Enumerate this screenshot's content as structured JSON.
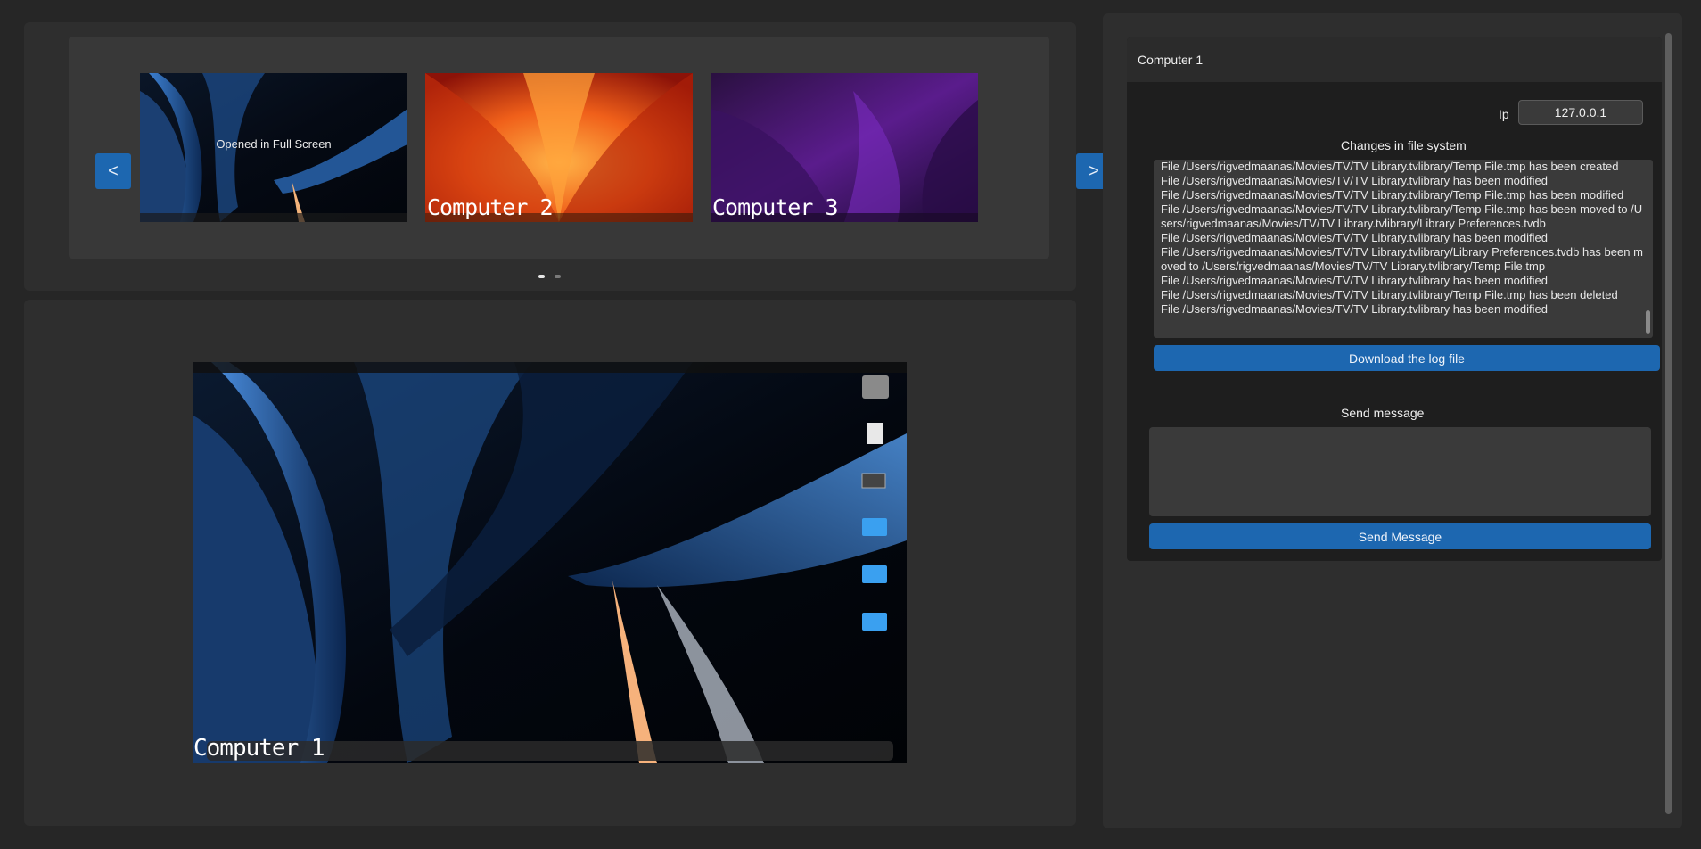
{
  "carousel": {
    "prev_label": "<",
    "next_label": ">",
    "thumbnails": [
      {
        "label": "",
        "overlay": "Opened in Full Screen",
        "wallpaper": "blue-abstract"
      },
      {
        "label": "Computer 2",
        "overlay": "",
        "wallpaper": "orange-flower"
      },
      {
        "label": "Computer 3",
        "overlay": "",
        "wallpaper": "purple-dark"
      }
    ],
    "pages": 2,
    "active_page": 1
  },
  "viewer": {
    "label": "Computer 1"
  },
  "side": {
    "title": "Computer 1",
    "ip_label": "Ip",
    "ip_value": "127.0.0.1",
    "log_title": "Changes in file system",
    "log_text": "File /Users/rigvedmaanas/Movies/TV/TV Library.tvlibrary/Temp File.tmp has been created\nFile /Users/rigvedmaanas/Movies/TV/TV Library.tvlibrary has been modified\nFile /Users/rigvedmaanas/Movies/TV/TV Library.tvlibrary/Temp File.tmp has been modified\nFile /Users/rigvedmaanas/Movies/TV/TV Library.tvlibrary/Temp File.tmp has been moved to /Users/rigvedmaanas/Movies/TV/TV Library.tvlibrary/Library Preferences.tvdb\nFile /Users/rigvedmaanas/Movies/TV/TV Library.tvlibrary has been modified\nFile /Users/rigvedmaanas/Movies/TV/TV Library.tvlibrary/Library Preferences.tvdb has been moved to /Users/rigvedmaanas/Movies/TV/TV Library.tvlibrary/Temp File.tmp\nFile /Users/rigvedmaanas/Movies/TV/TV Library.tvlibrary has been modified\nFile /Users/rigvedmaanas/Movies/TV/TV Library.tvlibrary/Temp File.tmp has been deleted\nFile /Users/rigvedmaanas/Movies/TV/TV Library.tvlibrary has been modified",
    "download_label": "Download the log file",
    "send_title": "Send message",
    "message_value": "",
    "send_label": "Send Message"
  },
  "colors": {
    "accent": "#1d67b0",
    "background": "#262626",
    "panel": "#2e2e2e"
  }
}
